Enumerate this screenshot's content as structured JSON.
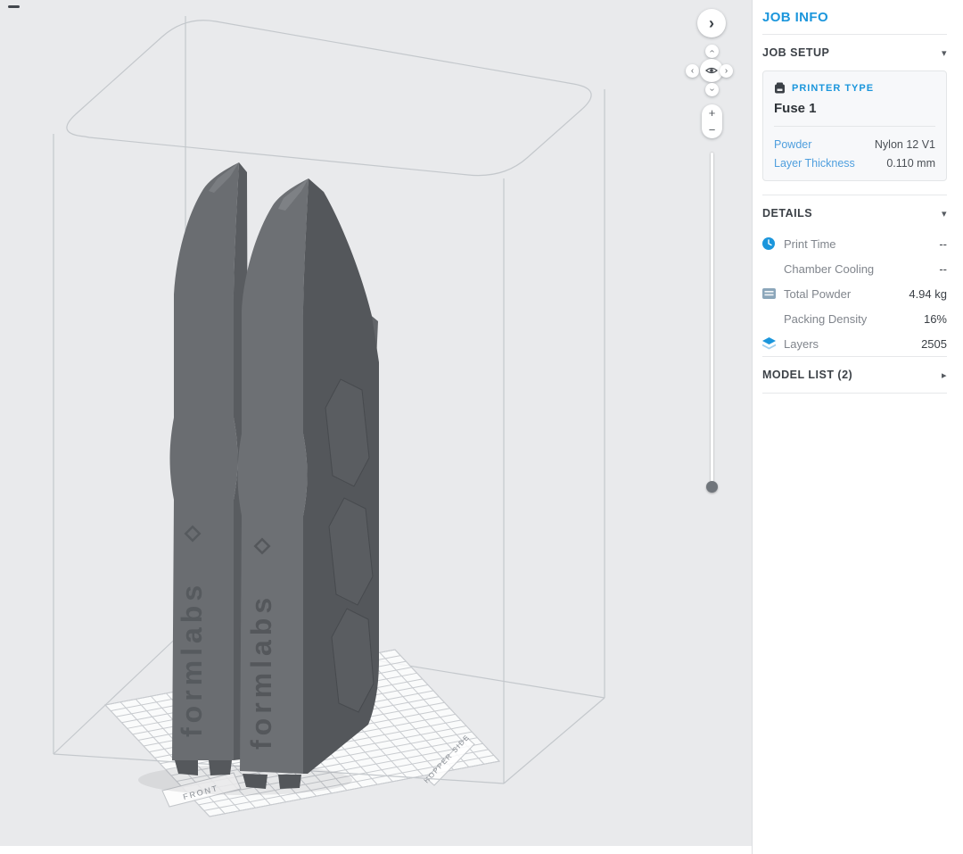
{
  "canvas": {
    "bed": {
      "front_label": "FRONT",
      "side_label": "HOPPER SIDE"
    },
    "models": {
      "brand_text": "formlabs",
      "count": 2
    },
    "controls": {
      "collapse_chevron": "›",
      "pad_up": "›",
      "pad_down": "›",
      "pad_left": "‹",
      "pad_right": "›",
      "zoom_in": "+",
      "zoom_out": "−"
    }
  },
  "panel": {
    "title": "JOB INFO",
    "job_setup": {
      "heading": "JOB SETUP",
      "collapse_icon": "▾",
      "printer_type_label": "PRINTER TYPE",
      "printer_name": "Fuse 1",
      "rows": [
        {
          "label": "Powder",
          "value": "Nylon 12 V1"
        },
        {
          "label": "Layer Thickness",
          "value": "0.110 mm"
        }
      ]
    },
    "details": {
      "heading": "DETAILS",
      "collapse_icon": "▾",
      "rows": [
        {
          "icon": "clock-icon",
          "label": "Print Time",
          "value": "--"
        },
        {
          "icon": "",
          "label": "Chamber Cooling",
          "value": "--"
        },
        {
          "icon": "powder-icon",
          "label": "Total Powder",
          "value": "4.94 kg"
        },
        {
          "icon": "",
          "label": "Packing Density",
          "value": "16%"
        },
        {
          "icon": "layers-icon",
          "label": "Layers",
          "value": "2505"
        }
      ]
    },
    "model_list": {
      "heading": "MODEL LIST (2)",
      "expand_icon": "▸"
    }
  },
  "colors": {
    "accent_blue": "#1b96dc",
    "canvas_bg": "#e9eaec",
    "model_gray": "#6a6d71"
  }
}
